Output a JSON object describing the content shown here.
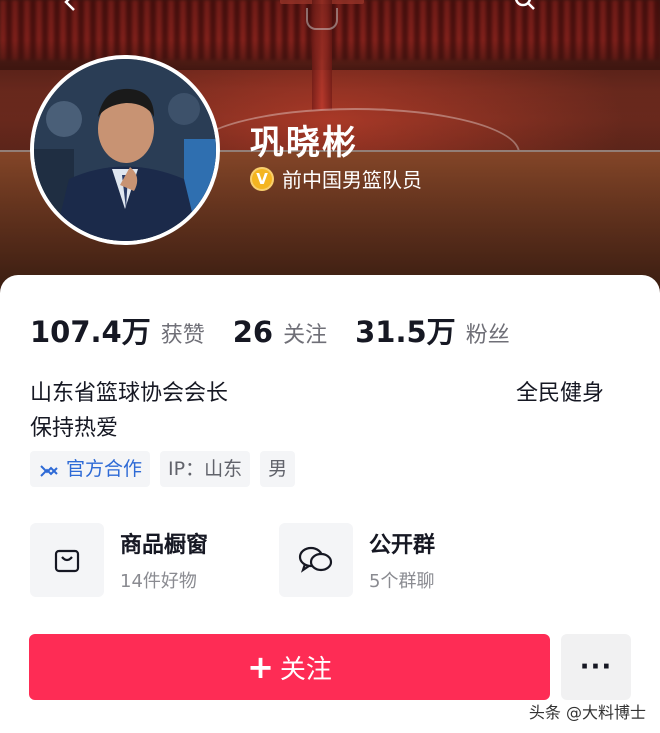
{
  "profile": {
    "name": "巩晓彬",
    "verified_badge": "V",
    "verified_text": "前中国男篮队员"
  },
  "stats": {
    "likes_value": "107.4万",
    "likes_label": "获赞",
    "following_value": "26",
    "following_label": "关注",
    "fans_value": "31.5万",
    "fans_label": "粉丝"
  },
  "bio": {
    "line1": "山东省篮球协会会长",
    "line1_right": "全民健身",
    "line2": "保持热爱"
  },
  "tags": {
    "official": "官方合作",
    "ip": "IP：山东",
    "gender": "男"
  },
  "entries": {
    "shop_title": "商品橱窗",
    "shop_sub": "14件好物",
    "group_title": "公开群",
    "group_sub": "5个群聊"
  },
  "actions": {
    "follow_plus": "+",
    "follow_label": "关注",
    "more_label": "···"
  },
  "watermark": "头条 @大料博士",
  "colors": {
    "follow_button": "#fe2c55",
    "verified_badge": "#f4b521",
    "official_tag": "#2e6ad6"
  },
  "icons": {
    "back": "chevron-left-icon",
    "search": "search-icon",
    "official": "handshake-icon",
    "shop": "shopping-bag-icon",
    "group": "chat-bubbles-icon"
  }
}
